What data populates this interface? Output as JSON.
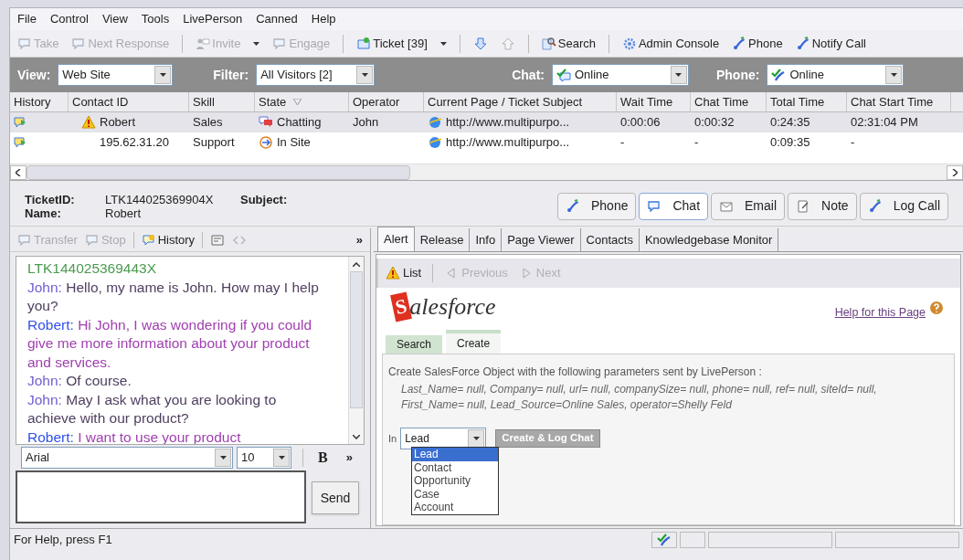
{
  "menu": [
    "File",
    "Control",
    "View",
    "Tools",
    "LivePerson",
    "Canned",
    "Help"
  ],
  "toolbar": [
    {
      "kind": "bubble",
      "label": "Take",
      "disabled": true,
      "caret": false
    },
    {
      "kind": "bubble",
      "label": "Next Response",
      "disabled": true,
      "caret": false
    },
    {
      "kind": "sep"
    },
    {
      "kind": "person",
      "label": "Invite",
      "disabled": true,
      "caret": true
    },
    {
      "kind": "bubble",
      "label": "Engage",
      "disabled": true,
      "caret": false
    },
    {
      "kind": "sep"
    },
    {
      "kind": "ticket",
      "label": "Ticket [39]",
      "disabled": false,
      "caret": true
    },
    {
      "kind": "sep"
    },
    {
      "kind": "down",
      "disabled": false,
      "caret": false
    },
    {
      "kind": "up",
      "disabled": true,
      "caret": false
    },
    {
      "kind": "sep"
    },
    {
      "kind": "search",
      "label": "Search",
      "disabled": false,
      "caret": false
    },
    {
      "kind": "sep"
    },
    {
      "kind": "gear",
      "label": "Admin Console",
      "disabled": false,
      "caret": false
    },
    {
      "kind": "phone",
      "label": "Phone",
      "disabled": false,
      "caret": false
    },
    {
      "kind": "phone",
      "label": "Notify Call",
      "disabled": false,
      "caret": false
    }
  ],
  "filters": [
    {
      "kind": "plain",
      "label": "View:",
      "value": "Web Site"
    },
    {
      "kind": "plain",
      "label": "Filter:",
      "value": "All Visitors [2]"
    },
    {
      "kind": "chat",
      "label": "Chat:",
      "value": "Online"
    },
    {
      "kind": "phone",
      "label": "Phone:",
      "value": "Online"
    }
  ],
  "table": {
    "columns": [
      "History",
      "Contact ID",
      "Skill",
      "State",
      "Operator",
      "Current Page / Ticket Subject",
      "Wait Time",
      "Chat Time",
      "Total Time",
      "Chat Start Time"
    ],
    "rows": [
      {
        "selected": true,
        "warning": true,
        "kind": "chat",
        "cells": [
          "",
          "Robert",
          "Sales",
          "Chatting",
          "John",
          "http://www.multipurpo...",
          "0:00:06",
          "0:00:32",
          "0:24:35",
          "02:31:04 PM"
        ]
      },
      {
        "selected": false,
        "warning": false,
        "kind": "site",
        "cells": [
          "",
          "195.62.31.20",
          "Support",
          "In Site",
          "",
          "http://www.multipurpo...",
          "-",
          "-",
          "0:09:35",
          "-"
        ]
      }
    ]
  },
  "ticket": {
    "id_label": "TicketID:",
    "id": "LTK144025369904X",
    "subject_label": "Subject:",
    "name_label": "Name:",
    "name": "Robert"
  },
  "channels": [
    {
      "label": "Phone",
      "kind": "phone",
      "selected": false
    },
    {
      "label": "Chat",
      "kind": "bubble",
      "selected": true
    },
    {
      "label": "Email",
      "kind": "envelope",
      "selected": false
    },
    {
      "label": "Note",
      "kind": "note",
      "selected": false
    },
    {
      "label": "Log Call",
      "kind": "phone",
      "selected": false
    }
  ],
  "chat_toolbar": [
    {
      "kind": "bubble",
      "label": "Transfer",
      "disabled": true
    },
    {
      "kind": "bubble",
      "label": "Stop",
      "disabled": true
    },
    {
      "kind": "history",
      "label": "History",
      "disabled": false
    },
    {
      "kind": "window",
      "disabled": false
    },
    {
      "kind": "brackets",
      "disabled": true
    }
  ],
  "chat_more": "»",
  "transcript": {
    "header": "LTK144025369443X",
    "messages": [
      {
        "kind": "operator",
        "speaker": "John:",
        "text": "Hello, my name is John. How may I help you?"
      },
      {
        "kind": "visitor",
        "speaker": "Robert:",
        "text": "Hi John, I was wondering if you could give me more information about your product and services."
      },
      {
        "kind": "operator",
        "speaker": "John:",
        "text": "Of course."
      },
      {
        "kind": "operator",
        "speaker": "John:",
        "text": "May I ask what you are looking to achieve with our product?"
      },
      {
        "kind": "visitor",
        "speaker": "Robert:",
        "text": "I want to use your product"
      }
    ]
  },
  "compose": {
    "font": "Arial",
    "size": "10",
    "bold": "B",
    "more": "»",
    "send": "Send"
  },
  "status_bar": "For Help, press F1",
  "right_tabs": [
    {
      "label": "Alert",
      "selected": true
    },
    {
      "label": "Release",
      "selected": false
    },
    {
      "label": "Info",
      "selected": false
    },
    {
      "label": "Page Viewer",
      "selected": false
    },
    {
      "label": "Contacts",
      "selected": false
    },
    {
      "label": "Knowledgebase Monitor",
      "selected": false
    }
  ],
  "alert_toolbar": [
    {
      "kind": "warning",
      "label": "List",
      "disabled": false
    },
    {
      "kind": "prev",
      "label": "Previous",
      "disabled": true
    },
    {
      "kind": "next",
      "label": "Next",
      "disabled": true
    }
  ],
  "salesforce": {
    "logo_initial": "S",
    "logo_rest": "alesforce",
    "help": "Help for this Page",
    "tabs": [
      {
        "label": "Search",
        "selected": false
      },
      {
        "label": "Create",
        "selected": true
      }
    ],
    "description": "Create SalesForce Object with the following parameters sent by LivePerson :",
    "params": "Last_Name= null, Company= null, url= null, companySize= null, phone= null, ref= null, siteId= null, First_Name= null, Lead_Source=Online Sales, operator=Shelly Feld",
    "in_label": "In",
    "object": "Lead",
    "button": "Create & Log Chat",
    "options": [
      {
        "label": "Lead",
        "selected": true
      },
      {
        "label": "Contact",
        "selected": false
      },
      {
        "label": "Opportunity",
        "selected": false
      },
      {
        "label": "Case",
        "selected": false
      },
      {
        "label": "Account",
        "selected": false
      }
    ]
  }
}
